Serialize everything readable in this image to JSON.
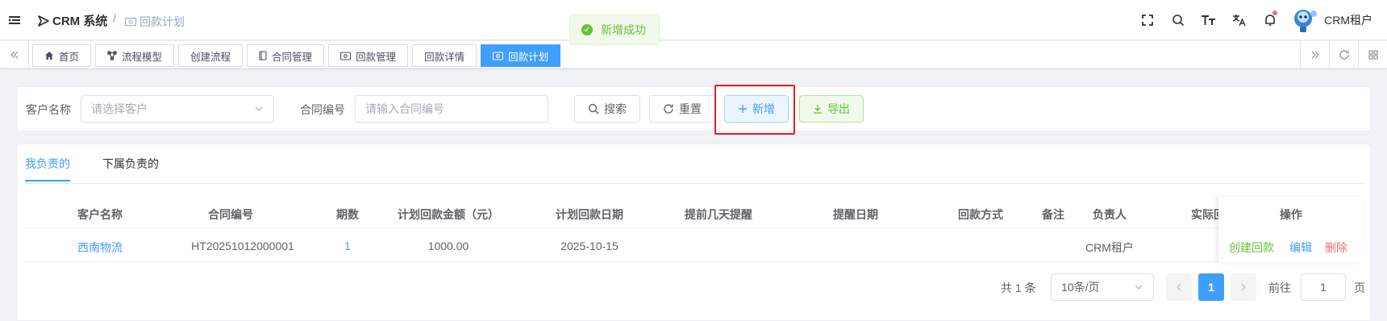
{
  "header": {
    "app_name": "CRM 系统",
    "breadcrumb_sep": "/",
    "breadcrumb_current": "回款计划",
    "user_name": "CRM租户"
  },
  "toast": {
    "message": "新增成功"
  },
  "tags": [
    {
      "label": "首页",
      "icon": "home-icon"
    },
    {
      "label": "流程模型",
      "icon": "flow-icon"
    },
    {
      "label": "创建流程",
      "icon": ""
    },
    {
      "label": "合同管理",
      "icon": "contract-icon"
    },
    {
      "label": "回款管理",
      "icon": "money-icon"
    },
    {
      "label": "回款详情",
      "icon": ""
    },
    {
      "label": "回款计划",
      "icon": "money-icon",
      "active": true
    }
  ],
  "search": {
    "customer_label": "客户名称",
    "customer_placeholder": "请选择客户",
    "contract_label": "合同编号",
    "contract_placeholder": "请输入合同编号",
    "search_btn": "搜索",
    "reset_btn": "重置",
    "add_btn": "新增",
    "export_btn": "导出"
  },
  "tabs": [
    {
      "label": "我负责的",
      "active": true
    },
    {
      "label": "下属负责的",
      "active": false
    }
  ],
  "table": {
    "columns": [
      "客户名称",
      "合同编号",
      "期数",
      "计划回款金额（元）",
      "计划回款日期",
      "提前几天提醒",
      "提醒日期",
      "回款方式",
      "备注",
      "负责人",
      "实际回",
      "操作"
    ],
    "rows": [
      {
        "customer": "西南物流",
        "contract_no": "HT20251012000001",
        "period": "1",
        "amount": "1000.00",
        "plan_date": "2025-10-15",
        "remind_days": "",
        "remind_date": "",
        "method": "",
        "remark": "",
        "owner": "CRM租户",
        "actions": [
          "创建回款",
          "编辑",
          "删除"
        ]
      }
    ]
  },
  "pagination": {
    "total_text": "共 1 条",
    "page_size": "10条/页",
    "current_page": "1",
    "goto_label": "前往",
    "goto_value": "1",
    "page_suffix": "页"
  },
  "colors": {
    "primary": "#409eff",
    "success": "#67c23a",
    "danger": "#f56c6c",
    "highlight": "#e02020"
  }
}
